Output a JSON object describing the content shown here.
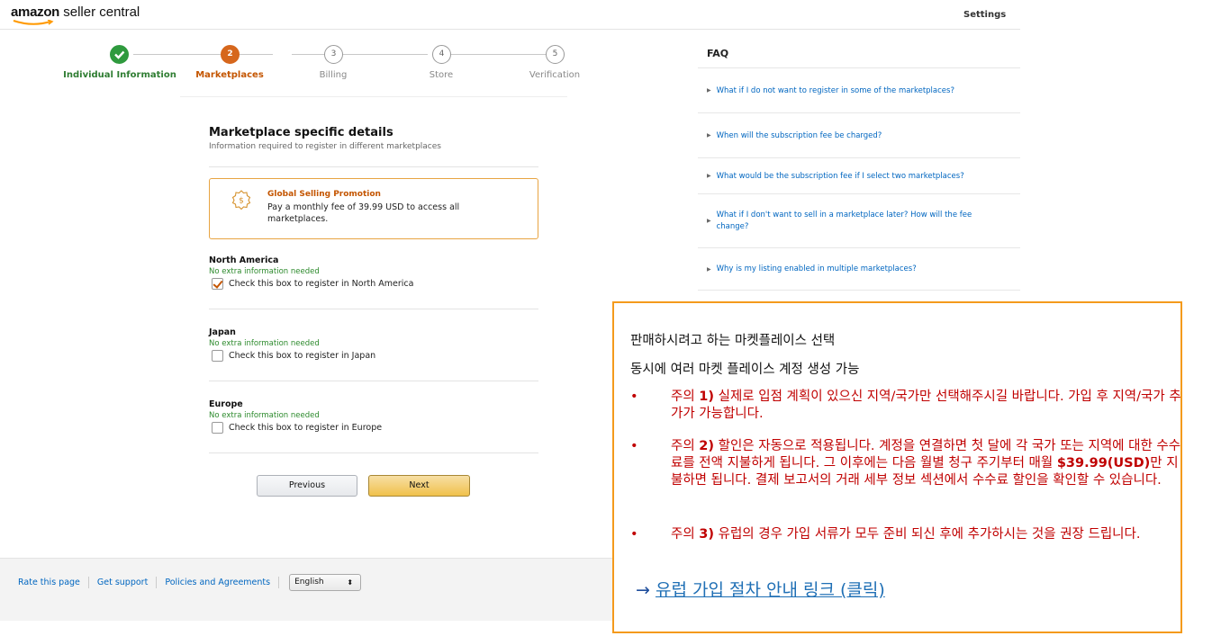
{
  "header": {
    "logo_brand": "amazon",
    "logo_rest": "seller central",
    "settings_label": "Settings"
  },
  "stepper": {
    "steps": [
      {
        "number": "",
        "label": "Individual Information",
        "state": "done"
      },
      {
        "number": "2",
        "label": "Marketplaces",
        "state": "current"
      },
      {
        "number": "3",
        "label": "Billing",
        "state": "pending"
      },
      {
        "number": "4",
        "label": "Store",
        "state": "pending"
      },
      {
        "number": "5",
        "label": "Verification",
        "state": "pending"
      }
    ]
  },
  "form": {
    "title": "Marketplace specific details",
    "subtitle": "Information required to register in different marketplaces",
    "promo": {
      "title": "Global Selling Promotion",
      "text": "Pay a monthly fee of 39.99 USD to access all marketplaces."
    },
    "regions": [
      {
        "name": "North America",
        "note": "No extra information needed",
        "check_label": "Check this box to register in North America",
        "checked": true
      },
      {
        "name": "Japan",
        "note": "No extra information needed",
        "check_label": "Check this box to register in Japan",
        "checked": false
      },
      {
        "name": "Europe",
        "note": "No extra information needed",
        "check_label": "Check this box to register in Europe",
        "checked": false
      }
    ],
    "previous_label": "Previous",
    "next_label": "Next"
  },
  "footer": {
    "links": [
      "Rate this page",
      "Get support",
      "Policies and Agreements"
    ],
    "language": "English"
  },
  "faq": {
    "title": "FAQ",
    "items": [
      "What if I do not want to register in some of the marketplaces?",
      "When will the subscription fee be charged?",
      "What would be the subscription fee if I select two marketplaces?",
      "What if I don't want to sell in a marketplace later? How will the fee change?",
      "Why is my listing enabled in multiple marketplaces?"
    ]
  },
  "note": {
    "line1": "판매하시려고 하는 마켓플레이스 선택",
    "line2": "동시에 여러 마켓 플레이스 계정 생성 가능",
    "bullets": [
      {
        "prefix": "주의 ",
        "num": "1)",
        "text": " 실제로 입점 계획이 있으신 지역/국가만 선택해주시길 바랍니다. 가입 후 지역/국가 추가가 가능합니다."
      },
      {
        "prefix": "주의 ",
        "num": "2)",
        "text_a": " 할인은 자동으로 적용됩니다. 계정을 연결하면 첫 달에 각 국가 또는 지역에 대한 수수료를 전액 지불하게 됩니다. 그 이후에는 다음 월별 청구 주기부터 매월 ",
        "amount": "$39.99(USD)",
        "text_b": "만 지불하면 됩니다. 결제 보고서의 거래 세부 정보 섹션에서 수수료 할인을 확인할 수 있습니다."
      },
      {
        "prefix": "주의 ",
        "num": "3)",
        "text": " 유럽의 경우 가입 서류가 모두 준비 되신 후에 추가하시는 것을 권장 드립니다."
      }
    ],
    "bullet_char": "•",
    "link_arrow": "→",
    "link_text": "유럽 가입 절차 안내 링크 (클릭)"
  },
  "colors": {
    "done": "#2f9a3e",
    "current": "#d6671d",
    "link": "#0066c0",
    "promo_border": "#e8a442",
    "note_border": "#f49a1c",
    "note_red": "#c00000"
  }
}
